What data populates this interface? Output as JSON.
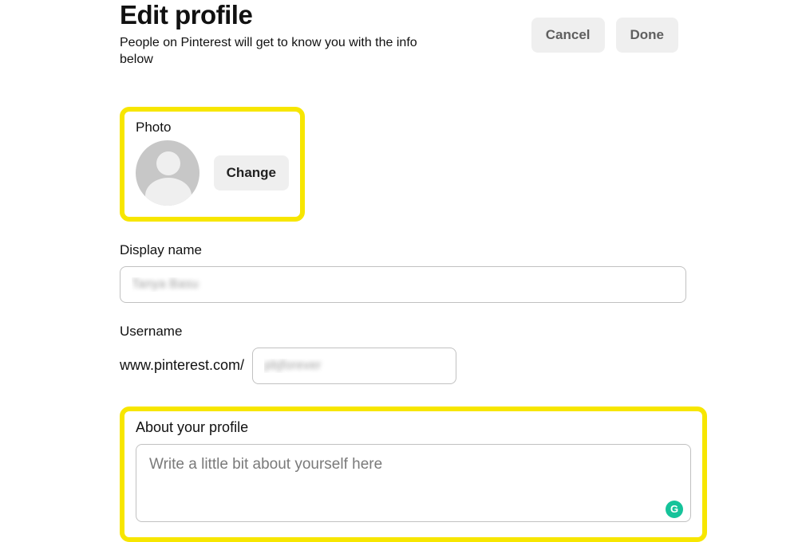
{
  "header": {
    "title": "Edit profile",
    "subtitle": "People on Pinterest will get to know you with the info below",
    "cancel_label": "Cancel",
    "done_label": "Done"
  },
  "photo": {
    "label": "Photo",
    "change_label": "Change"
  },
  "display_name": {
    "label": "Display name",
    "value": "Tanya Basu"
  },
  "username": {
    "label": "Username",
    "prefix": "www.pinterest.com/",
    "value": "pbjforever"
  },
  "about": {
    "label": "About your profile",
    "placeholder": "Write a little bit about yourself here"
  },
  "grammarly_glyph": "G"
}
